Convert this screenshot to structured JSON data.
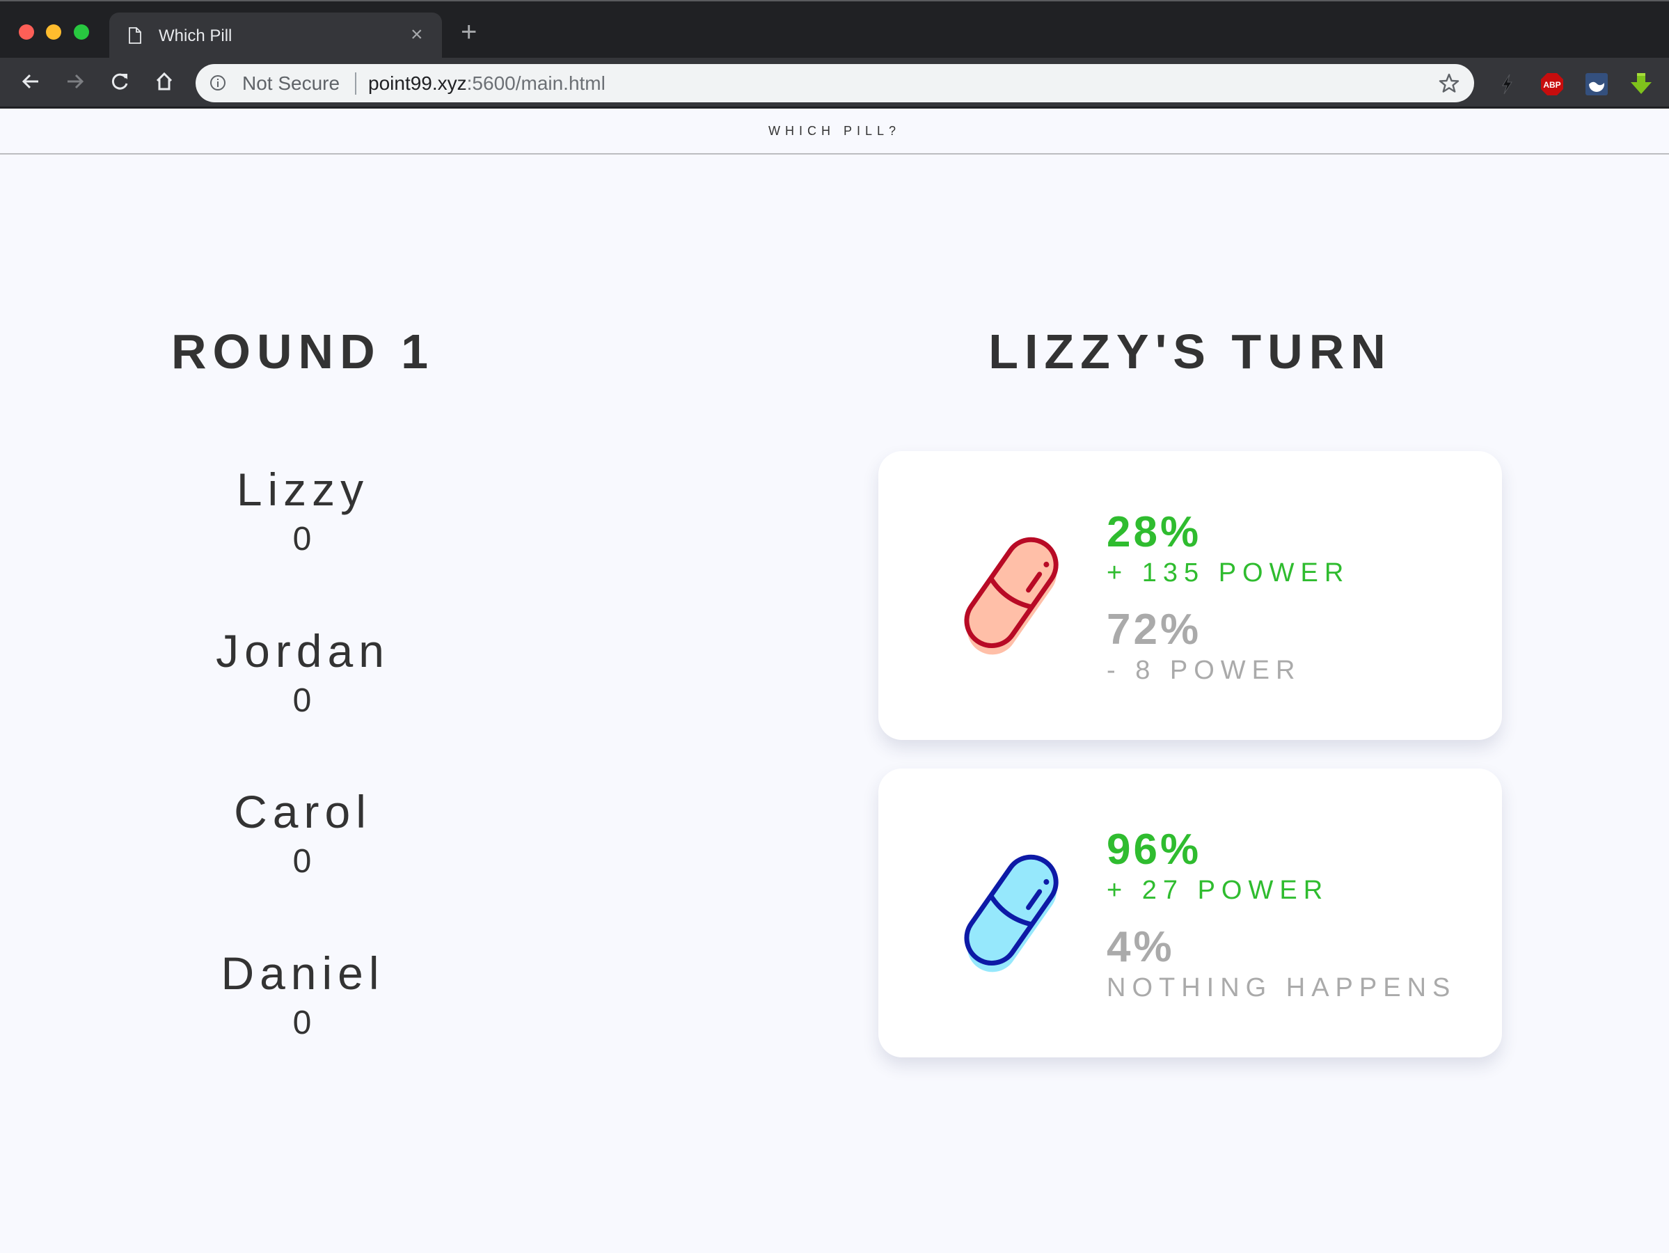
{
  "browser": {
    "tab_title": "Which Pill",
    "tab_close": "×",
    "new_tab": "+",
    "security_label": "Not Secure",
    "url_host": "point99.xyz",
    "url_rest": ":5600/main.html",
    "extensions": [
      "bolt-icon",
      "adblock-plus-icon",
      "extension-circle-icon",
      "download-arrow-icon"
    ],
    "colors": {
      "close": "#fe5f57",
      "minimize": "#febc2e",
      "maximize": "#28c840"
    }
  },
  "header": {
    "brand": "WHICH PILL?"
  },
  "round": {
    "title": "ROUND 1"
  },
  "players": [
    {
      "name": "Lizzy",
      "score": "0"
    },
    {
      "name": "Jordan",
      "score": "0"
    },
    {
      "name": "Carol",
      "score": "0"
    },
    {
      "name": "Daniel",
      "score": "0"
    }
  ],
  "turn": {
    "title": "LIZZY'S TURN"
  },
  "pills": [
    {
      "color": "red",
      "stroke": "#b80a25",
      "fill": "#ffbfa8",
      "good_chance": "28%",
      "good_effect": "+ 135 POWER",
      "bad_chance": "72%",
      "bad_effect": "- 8 POWER"
    },
    {
      "color": "blue",
      "stroke": "#0d1aa6",
      "fill": "#96e8fc",
      "good_chance": "96%",
      "good_effect": "+ 27 POWER",
      "bad_chance": "4%",
      "bad_effect": "NOTHING HAPPENS"
    }
  ],
  "theme": {
    "good": "#2fbc2f",
    "bad": "#aaaaaa",
    "text": "#333333",
    "background": "#f8f9fe"
  }
}
